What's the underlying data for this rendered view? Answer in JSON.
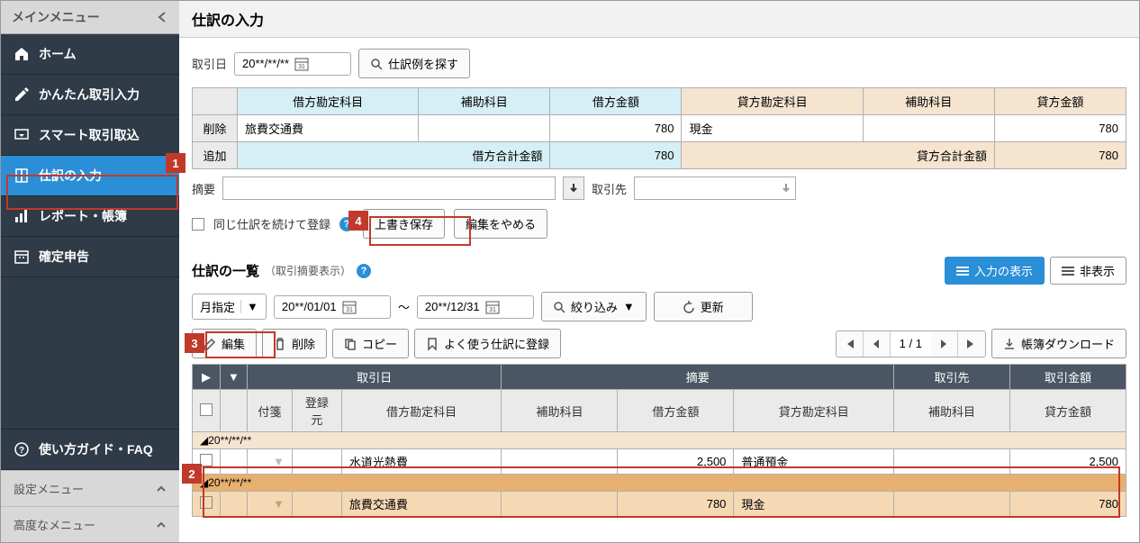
{
  "sidebar": {
    "header": "メインメニュー",
    "items": [
      {
        "label": "ホーム"
      },
      {
        "label": "かんたん取引入力"
      },
      {
        "label": "スマート取引取込"
      },
      {
        "label": "仕訳の入力"
      },
      {
        "label": "レポート・帳簿"
      },
      {
        "label": "確定申告"
      }
    ],
    "faq": "使い方ガイド・FAQ",
    "footer": [
      {
        "label": "設定メニュー"
      },
      {
        "label": "高度なメニュー"
      }
    ]
  },
  "main": {
    "title": "仕訳の入力",
    "entry": {
      "date_label": "取引日",
      "date_value": "20**/**/**",
      "search_example": "仕訳例を探す",
      "headers": {
        "debit_account": "借方勘定科目",
        "debit_sub": "補助科目",
        "debit_amount": "借方金額",
        "credit_account": "貸方勘定科目",
        "credit_sub": "補助科目",
        "credit_amount": "貸方金額"
      },
      "row_delete": "削除",
      "row_add": "追加",
      "row1": {
        "debit_account": "旅費交通費",
        "debit_amount": "780",
        "credit_account": "現金",
        "credit_amount": "780"
      },
      "totals": {
        "debit_label": "借方合計金額",
        "debit_amount": "780",
        "credit_label": "貸方合計金額",
        "credit_amount": "780"
      },
      "summary_label": "摘要",
      "partner_label": "取引先",
      "continue_label": "同じ仕訳を続けて登録",
      "save_btn": "上書き保存",
      "cancel_btn": "編集をやめる"
    },
    "list": {
      "title": "仕訳の一覧",
      "title_sub": "（取引摘要表示）",
      "view_show": "入力の表示",
      "view_hide": "非表示",
      "filter": {
        "period": "月指定",
        "date_from": "20**/01/01",
        "date_sep": "～",
        "date_to": "20**/12/31",
        "narrow": "絞り込み",
        "refresh": "更新"
      },
      "toolbar": {
        "edit": "編集",
        "delete": "削除",
        "copy": "コピー",
        "favorite": "よく使う仕訳に登録",
        "page_current": "1",
        "page_sep": "/",
        "page_total": "1",
        "download": "帳簿ダウンロード"
      },
      "headers": {
        "date": "取引日",
        "summary": "摘要",
        "partner": "取引先",
        "amount": "取引金額",
        "tag": "付箋",
        "source": "登録元",
        "debit_account": "借方勘定科目",
        "debit_sub": "補助科目",
        "debit_amount": "借方金額",
        "credit_account": "貸方勘定科目",
        "credit_sub": "補助科目",
        "credit_amount": "貸方金額"
      },
      "group1": {
        "date": "20**/**/**",
        "debit_account": "水道光熱費",
        "debit_amount": "2,500",
        "credit_account": "普通預金",
        "credit_amount": "2,500"
      },
      "group2": {
        "date": "20**/**/**",
        "debit_account": "旅費交通費",
        "debit_amount": "780",
        "credit_account": "現金",
        "credit_amount": "780"
      }
    }
  },
  "callouts": {
    "c1": "1",
    "c2": "2",
    "c3": "3",
    "c4": "4"
  }
}
